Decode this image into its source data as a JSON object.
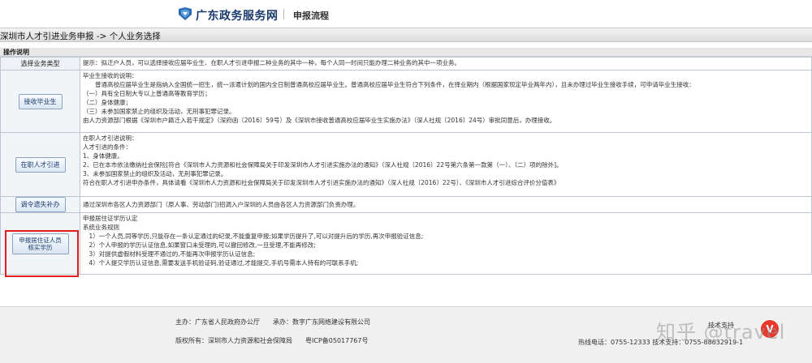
{
  "header": {
    "site_name": "广东政务服务网",
    "sub_title": "申报流程"
  },
  "title_bar": "深圳市人才引进业务申报 -> 个人业务选择",
  "section_label": "操作说明",
  "table": {
    "head": {
      "label": "选择业务类型",
      "text": "提示：拟迁户人员，可以选择接收应届毕业生、在职人才引进申报二种业务的其中一种，每个人同一时间只能办理二种业务的其中一项业务。"
    },
    "rows": [
      {
        "button": "接收毕业生",
        "lines": [
          "毕业生接收的说明：",
          "　　普通高校应届毕业生是指纳入全国统一招生，统一派遣计划的国内全日制普通高校应届毕业生。普通高校应届毕业生符合下列条件，在择业期内（根据国家现定毕业两年内），且未办理过毕业生接收手续，可申请毕业生接收：",
          "（一）具有全日制大专以上普通高等教育学历；",
          "（二）身体健康；",
          "（三）未参加国家禁止的组织及活动，无刑事犯罪记录。",
          "由人力资源部门根据《深圳市户籍迁入若干规定》（深府函〔2016〕59号）及《深圳市接收普通高校应届毕业生实施办法》（深人社规〔2016〕24号）审批同意后，办理接收。"
        ]
      },
      {
        "button": "在职人才引进",
        "lines": [
          "在职人才引进说明：",
          "人才引进的条件：",
          "1、身体健康。",
          "2、已在本市依法缴纳社会保险[符合《深圳市人力资源和社会保障局关于印发深圳市人才引进实施办法的通知》（深人社规〔2016〕22号第六条第一款第（一）、（二）项的除外]。",
          "3、未参加国家禁止的组织及活动，无刑事犯罪记录。",
          "符合在职人才引进申办条件，具体请看《深圳市人力资源和社会保障局关于印发深圳市人才引进实施办法的通知》（深人社规〔2016〕22号）、《深圳市人才引进综合评价分值表》"
        ]
      },
      {
        "button": "调令遗失补办",
        "lines": [
          "通过深圳市各区人力资源部门（原人事、劳动部门)招调入户深圳的人员由各区人力资源部门负责办理。"
        ]
      },
      {
        "button": "申报居住证人员核实学历",
        "lines": [
          "申报居住证学历认定",
          "系统业务规则",
          "　1）一个人员,同等学历,只能存在一条认定通过的纪录,不能重复申报;如果学历提升了,可以对提升后的学历,再次申报验证信息;",
          "　2）个人申报的学历认证信息,如果窗口未受理的,可以撤回修改,一旦受理,不能再修改;",
          "　3）对提供虚假材料受理不通过的,不能再次申报学历认证信息;",
          "　4）个人提交学历认证信息,需要发送手机验证码,验证通过,才能提交,手机号需本人持有的可联系手机;"
        ]
      }
    ]
  },
  "footer": {
    "host_label": "主办：广东省人民政府办公厅",
    "operator_label": "承办：数字广东网络建设有限公司",
    "copyright_label": "版权所有：深圳市人力资源和社会保障局",
    "icp_label": "粤ICP备05017767号",
    "tech_support": "技术支持",
    "hotline": "热线电话：0755-12333 技术支持：0755-88632919-1"
  },
  "watermark": "知乎 @travel",
  "colors": {
    "highlight_border": "#e31d1d",
    "brand": "#1a3a6e"
  }
}
